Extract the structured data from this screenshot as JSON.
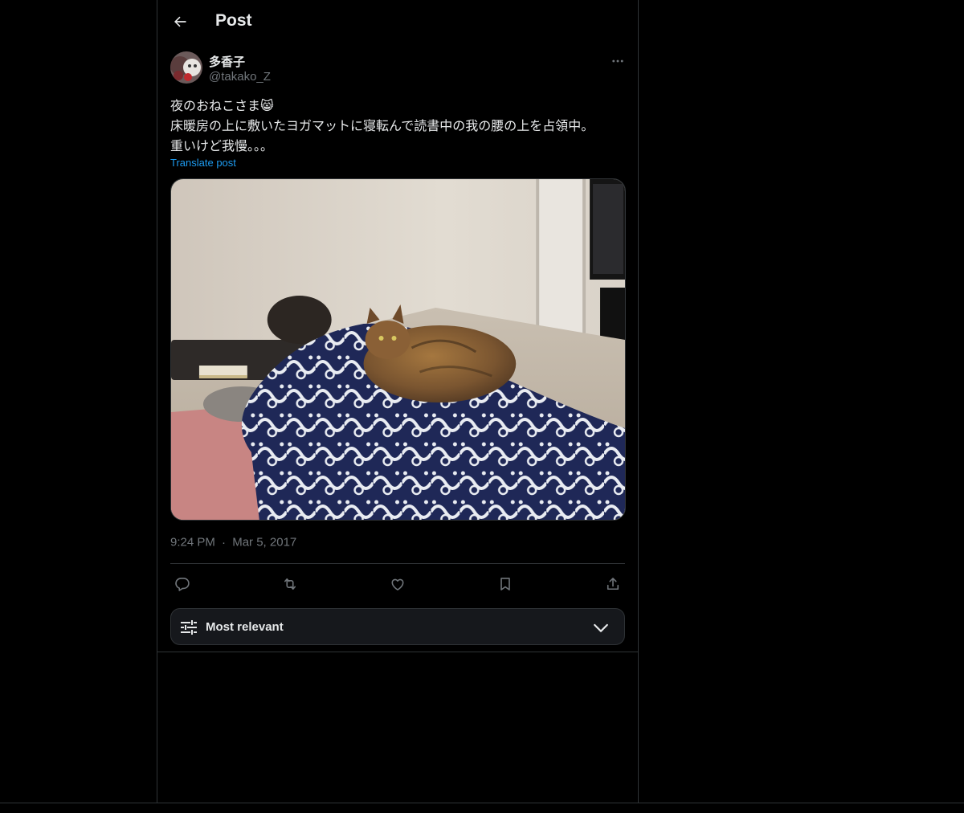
{
  "header": {
    "title": "Post"
  },
  "author": {
    "name": "多香子",
    "handle": "@takako_Z"
  },
  "post": {
    "lines": [
      "夜のおねこさま😸",
      "床暖房の上に敷いたヨガマットに寝転んで読書中の我の腰の上を占領中。",
      "重いけど我慢。。。"
    ],
    "translate_label": "Translate post",
    "time": "9:24 PM",
    "separator": "·",
    "date": "Mar 5, 2017"
  },
  "actions": [
    "reply-icon",
    "repost-icon",
    "like-icon",
    "bookmark-icon",
    "share-icon"
  ],
  "sort": {
    "label": "Most relevant"
  },
  "colors": {
    "background": "#000000",
    "accent": "#1d9bf0",
    "muted": "#71767b",
    "border": "#2f3336",
    "text": "#e7e9ea"
  }
}
